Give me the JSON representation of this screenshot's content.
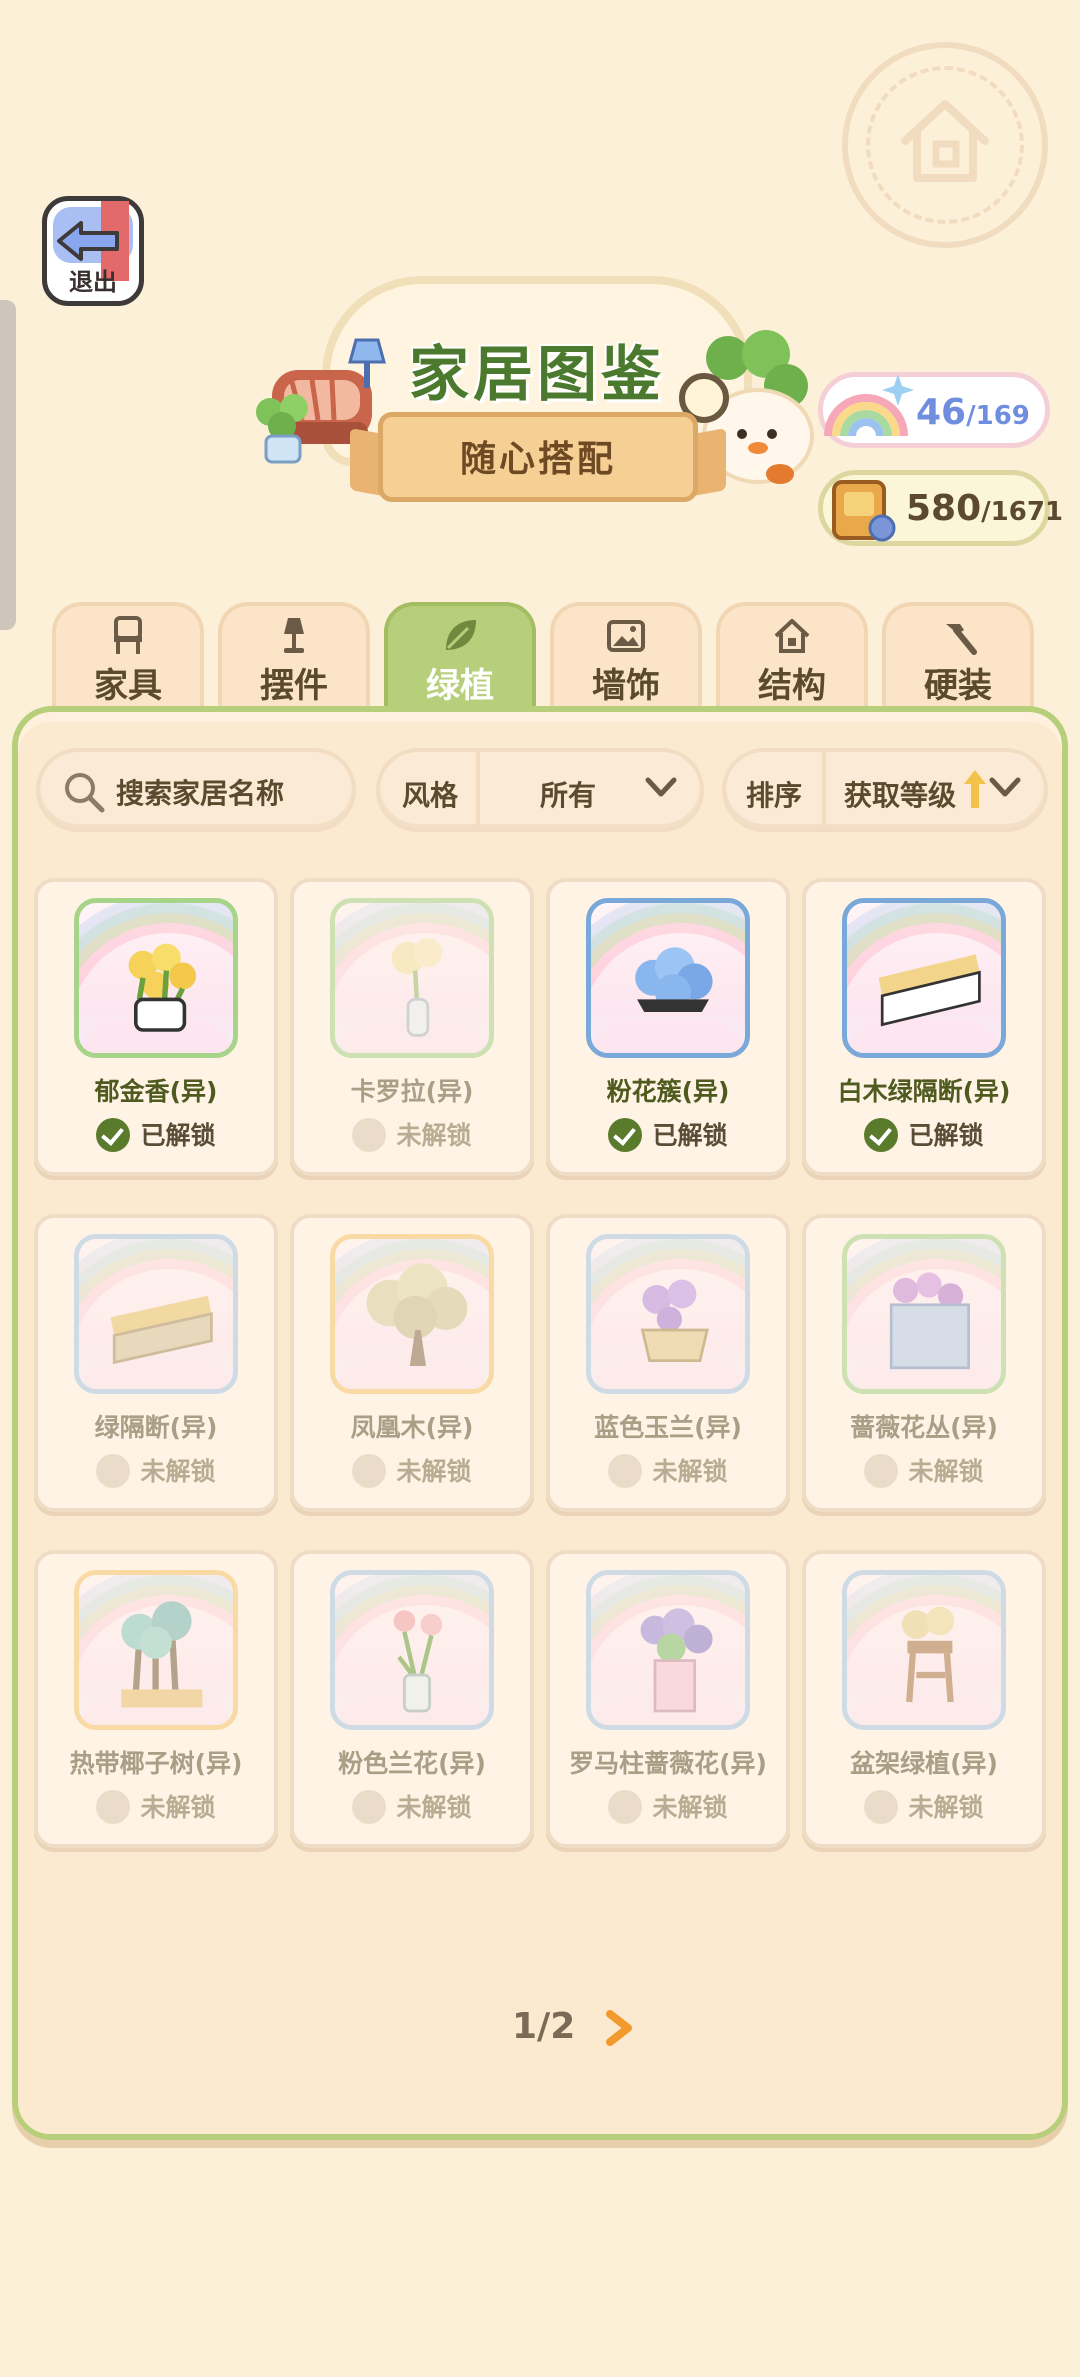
{
  "header": {
    "exit_label": "退出",
    "title": "家居图鉴",
    "subtitle": "随心搭配"
  },
  "counters": {
    "collect_current": "46",
    "collect_total": "/169",
    "points_current": "580",
    "points_total": "/1671"
  },
  "tabs": [
    {
      "label": "家具",
      "icon": "chair-icon",
      "active": false
    },
    {
      "label": "摆件",
      "icon": "lamp-icon",
      "active": false
    },
    {
      "label": "绿植",
      "icon": "leaf-icon",
      "active": true
    },
    {
      "label": "墙饰",
      "icon": "picture-icon",
      "active": false
    },
    {
      "label": "结构",
      "icon": "house-icon",
      "active": false
    },
    {
      "label": "硬装",
      "icon": "hammer-icon",
      "active": false
    }
  ],
  "filters": {
    "search_placeholder": "搜索家居名称",
    "style_key": "风格",
    "style_value": "所有",
    "sort_key": "排序",
    "sort_value": "获取等级"
  },
  "items": [
    {
      "name": "郁金香(异)",
      "status": "已解锁",
      "unlocked": true
    },
    {
      "name": "卡罗拉(异)",
      "status": "未解锁",
      "unlocked": false
    },
    {
      "name": "粉花簇(异)",
      "status": "已解锁",
      "unlocked": true
    },
    {
      "name": "白木绿隔断(异)",
      "status": "已解锁",
      "unlocked": true
    },
    {
      "name": "绿隔断(异)",
      "status": "未解锁",
      "unlocked": false
    },
    {
      "name": "凤凰木(异)",
      "status": "未解锁",
      "unlocked": false
    },
    {
      "name": "蓝色玉兰(异)",
      "status": "未解锁",
      "unlocked": false
    },
    {
      "name": "蔷薇花丛(异)",
      "status": "未解锁",
      "unlocked": false
    },
    {
      "name": "热带椰子树(异)",
      "status": "未解锁",
      "unlocked": false
    },
    {
      "name": "粉色兰花(异)",
      "status": "未解锁",
      "unlocked": false
    },
    {
      "name": "罗马柱蔷薇花(异)",
      "status": "未解锁",
      "unlocked": false
    },
    {
      "name": "盆架绿植(异)",
      "status": "未解锁",
      "unlocked": false
    }
  ],
  "pager": {
    "label": "1/2"
  }
}
